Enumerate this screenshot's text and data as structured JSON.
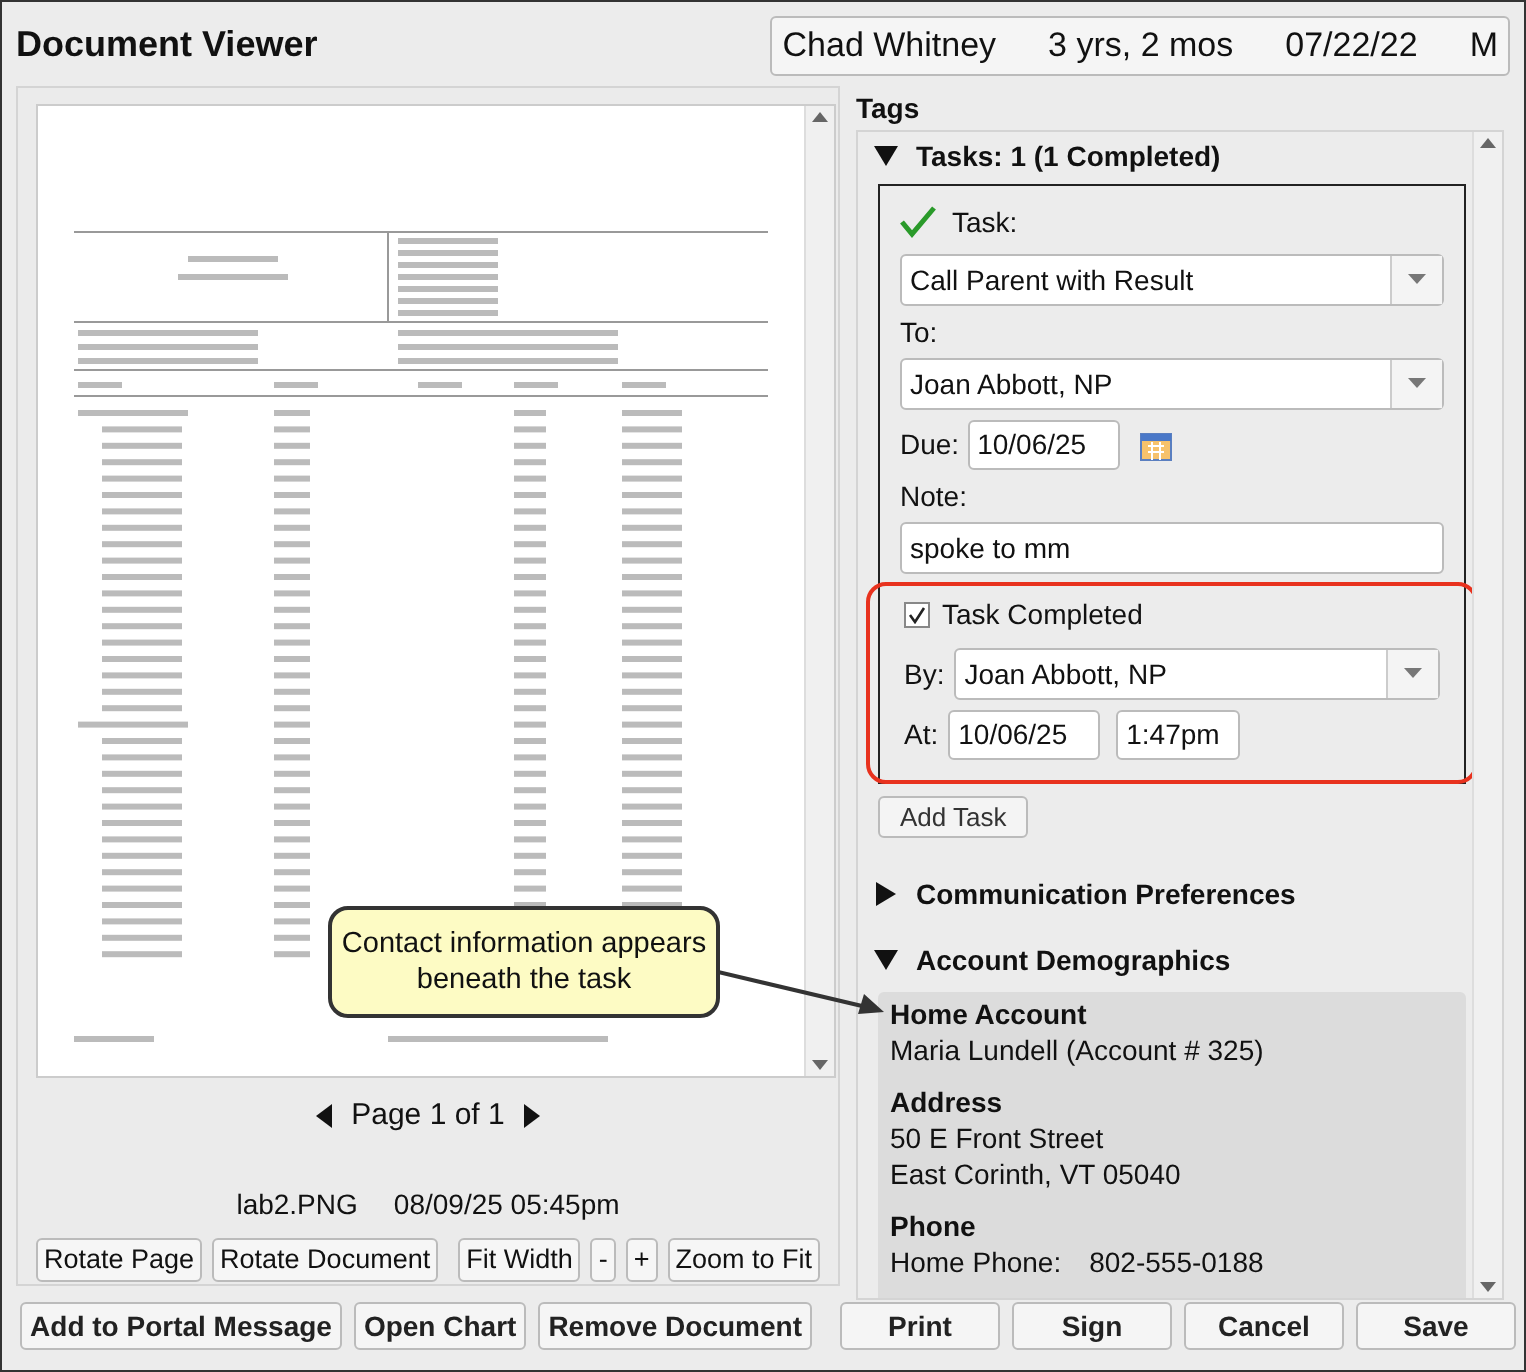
{
  "window": {
    "title": "Document Viewer"
  },
  "patient_banner": {
    "name": "Chad Whitney",
    "age": "3 yrs, 2 mos",
    "dob": "07/22/22",
    "sex": "M"
  },
  "document": {
    "pager": {
      "label": "Page",
      "current": "1",
      "of": "of",
      "total": "1"
    },
    "file_name": "lab2.PNG",
    "timestamp": "08/09/25 05:45pm",
    "tools": [
      "Rotate Page",
      "Rotate Document",
      "Fit Width",
      "-",
      "+",
      "Zoom to Fit"
    ]
  },
  "tags": {
    "title": "Tags",
    "tasks_section": {
      "title": "Tasks: 1 (1 Completed)",
      "expanded": true,
      "task": {
        "task_label": "Task:",
        "task_value": "Call Parent with Result",
        "to_label": "To:",
        "to_value": "Joan Abbott, NP",
        "due_label": "Due:",
        "due_value": "10/06/25",
        "note_label": "Note:",
        "note_value": "spoke to mm",
        "completed": {
          "label": "Task Completed",
          "checked": true
        },
        "by_label": "By:",
        "by_value": "Joan Abbott, NP",
        "at_label": "At:",
        "at_date": "10/06/25",
        "at_time": "1:47pm"
      },
      "add_button": "Add Task"
    },
    "communication_section": {
      "title": "Communication Preferences",
      "expanded": false
    },
    "demographics_section": {
      "title": "Account Demographics",
      "expanded": true,
      "groups": [
        {
          "heading": "Home Account",
          "lines": [
            {
              "text": "Maria Lundell (Account # 325)"
            }
          ]
        },
        {
          "heading": "Address",
          "lines": [
            {
              "text": "50 E Front Street"
            },
            {
              "text": "East Corinth, VT 05040"
            }
          ]
        },
        {
          "heading": "Phone",
          "lines": [
            {
              "label": "Home Phone:",
              "text": "802-555-0188"
            }
          ]
        }
      ]
    }
  },
  "callout": {
    "text": "Contact information appears beneath the task"
  },
  "footer_buttons": [
    "Add to Portal Message",
    "Open Chart",
    "Remove Document",
    "Print",
    "Sign",
    "Cancel",
    "Save"
  ]
}
